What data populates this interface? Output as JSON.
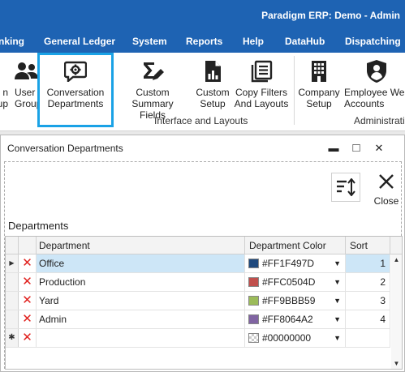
{
  "app": {
    "title": "Paradigm ERP: Demo - Admin"
  },
  "menu": [
    {
      "label": "nking"
    },
    {
      "label": "General Ledger"
    },
    {
      "label": "System"
    },
    {
      "label": "Reports"
    },
    {
      "label": "Help"
    },
    {
      "label": "DataHub"
    },
    {
      "label": "Dispatching"
    }
  ],
  "ribbon": {
    "buttons": [
      {
        "label": "n\nup",
        "icon": "partial-icon"
      },
      {
        "label": "User\nGroups",
        "icon": "users-icon"
      },
      {
        "label": "Conversation\nDepartments",
        "icon": "chat-gear-icon"
      },
      {
        "label": "Custom Summary\nFields",
        "icon": "sigma-edit-icon"
      },
      {
        "label": "Custom\nSetup",
        "icon": "file-chart-icon"
      },
      {
        "label": "Copy Filters\nAnd Layouts",
        "icon": "copy-list-icon"
      },
      {
        "label": "Company\nSetup",
        "icon": "building-icon"
      },
      {
        "label": "Employee Web\nAccounts",
        "icon": "user-shield-icon"
      }
    ],
    "groups": [
      {
        "label": "Interface and Layouts"
      },
      {
        "label": "Administration"
      }
    ]
  },
  "window": {
    "title": "Conversation Departments",
    "minimize": "▬",
    "maximize": "□",
    "close": "✕",
    "close_tool_label": "Close",
    "section_label": "Departments"
  },
  "grid": {
    "columns": [
      "Department",
      "Department Color",
      "Sort"
    ],
    "rows": [
      {
        "department": "Office",
        "color_text": "#FF1F497D",
        "color": "#1f497d",
        "sort": "1",
        "selected": true
      },
      {
        "department": "Production",
        "color_text": "#FFC0504D",
        "color": "#c0504d",
        "sort": "2"
      },
      {
        "department": "Yard",
        "color_text": "#FF9BBB59",
        "color": "#9bbb59",
        "sort": "3"
      },
      {
        "department": "Admin",
        "color_text": "#FF8064A2",
        "color": "#8064a2",
        "sort": "4"
      }
    ],
    "new_row": {
      "department": "",
      "color_text": "#00000000",
      "sort": ""
    }
  },
  "colors": {
    "brand": "#1e63b3",
    "highlight": "#1aa2e6",
    "selected_row": "#cde6f7",
    "delete": "#e0201d"
  }
}
